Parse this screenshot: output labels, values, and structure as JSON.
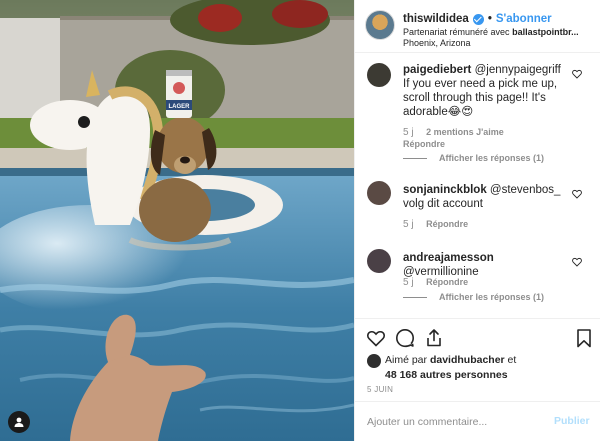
{
  "post": {
    "author": "thiswildidea",
    "verified": true,
    "follow_label": "S'abonner",
    "separator": "•",
    "partnership_prefix": "Partenariat rémunéré avec",
    "partner": "ballastpointbr...",
    "location": "Phoenix, Arizona"
  },
  "photo": {
    "subject": "dog in unicorn pool float wearing a can",
    "can_label": "LAGER",
    "user_tag_icon": "user-icon"
  },
  "comments": [
    {
      "user": "paigediebert",
      "text": "@jennypaigegriff If you ever need a pick me up, scroll through this page!! It's adorable😂😍",
      "time": "5 j",
      "likes": "2 mentions J'aime",
      "reply_label": "Répondre",
      "view_replies": "Afficher les réponses (1)",
      "avatar_color": "#3c3a33"
    },
    {
      "user": "sonjaninckblok",
      "text": "@stevenbos_ volg dit account",
      "time": "5 j",
      "reply_label": "Répondre",
      "avatar_color": "#5a4a44"
    },
    {
      "user": "andreajamesson",
      "text": "@vermillionine",
      "time": "5 j",
      "reply_label": "Répondre",
      "view_replies": "Afficher les réponses (1)",
      "avatar_color": "#4a4046"
    }
  ],
  "actions": {
    "like_icon": "heart-icon",
    "comment_icon": "comment-icon",
    "share_icon": "share-icon",
    "save_icon": "bookmark-icon"
  },
  "likes": {
    "prefix": "Aimé par",
    "user": "davidhubacher",
    "connector": "et",
    "others": "48 168 autres personnes"
  },
  "date": "5 JUIN",
  "add_comment": {
    "placeholder": "Ajouter un commentaire...",
    "publish_label": "Publier"
  },
  "colors": {
    "link_blue": "#3897f0",
    "muted_gray": "#8e8e8e",
    "publish_disabled": "#b2dffc"
  }
}
